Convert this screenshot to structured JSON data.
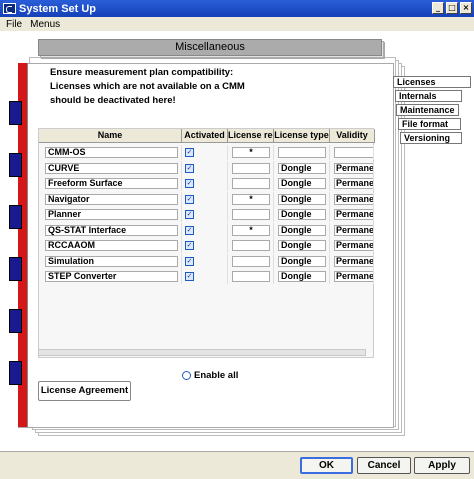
{
  "window": {
    "title": "System Set Up"
  },
  "menu": {
    "file": "File",
    "menus": "Menus"
  },
  "misc_tab": "Miscellaneous",
  "notice": {
    "line1": "Ensure measurement plan compatibility:",
    "line2": "Licenses which are not available on a CMM",
    "line3": "should be deactivated here!"
  },
  "right_tabs": [
    "Licenses",
    "Internals",
    "Maintenance",
    "File format",
    "Versioning"
  ],
  "table": {
    "headers": [
      "Name",
      "Activated",
      "License requ",
      "License type",
      "Validity"
    ],
    "rows": [
      {
        "name": "CMM-OS",
        "activated": "✓",
        "req": "*",
        "type": "",
        "validity": ""
      },
      {
        "name": "CURVE",
        "activated": "✓",
        "req": "",
        "type": "Dongle",
        "validity": "Permanent"
      },
      {
        "name": "Freeform Surface",
        "activated": "✓",
        "req": "",
        "type": "Dongle",
        "validity": "Permanent"
      },
      {
        "name": "Navigator",
        "activated": "✓",
        "req": "*",
        "type": "Dongle",
        "validity": "Permanent"
      },
      {
        "name": "Planner",
        "activated": "✓",
        "req": "",
        "type": "Dongle",
        "validity": "Permanent"
      },
      {
        "name": "QS-STAT Interface",
        "activated": "✓",
        "req": "*",
        "type": "Dongle",
        "validity": "Permanent"
      },
      {
        "name": "RCCAAOM",
        "activated": "✓",
        "req": "",
        "type": "Dongle",
        "validity": "Permanent"
      },
      {
        "name": "Simulation",
        "activated": "✓",
        "req": "",
        "type": "Dongle",
        "validity": "Permanent"
      },
      {
        "name": "STEP Converter",
        "activated": "✓",
        "req": "",
        "type": "Dongle",
        "validity": "Permanent"
      }
    ]
  },
  "enable_all": "Enable all",
  "license_agreement": "License Agreement",
  "buttons": {
    "ok": "OK",
    "cancel": "Cancel",
    "apply": "Apply"
  },
  "icons": {
    "minimize": "minimize-icon",
    "maximize": "maximize-icon",
    "close": "close-icon"
  },
  "colors": {
    "titlebar": "#1540b8",
    "accent_red": "#d41818",
    "tab_blue": "#1a1a90"
  }
}
